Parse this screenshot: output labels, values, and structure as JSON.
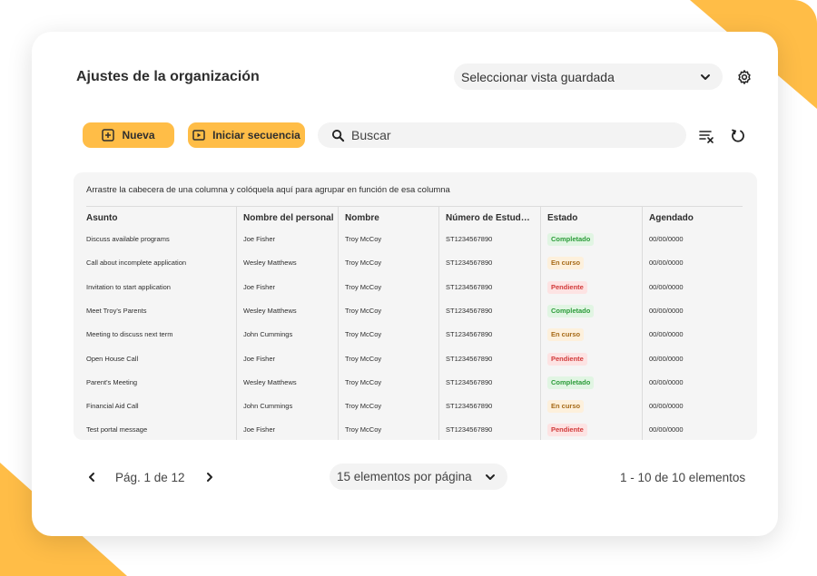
{
  "colors": {
    "accent": "#ffbd47",
    "completed": "#2c9c3a",
    "in_progress": "#a66a18",
    "pending": "#d13b3b"
  },
  "header": {
    "title": "Ajustes de la organización",
    "saved_view_select": "Seleccionar vista guardada",
    "settings_icon": "gear-icon"
  },
  "toolbar": {
    "new_label": "Nueva",
    "sequence_label": "Iniciar secuencia",
    "search_placeholder": "Buscar",
    "clear_filters_icon": "clear-filter-icon",
    "refresh_icon": "refresh-icon"
  },
  "table": {
    "group_hint": "Arrastre la cabecera de una columna y colóquela aquí para agrupar en función de esa columna",
    "columns": [
      "Asunto",
      "Nombre del personal",
      "Nombre",
      "Número de Estud…",
      "Estado",
      "Agendado"
    ],
    "rows": [
      {
        "asunto": "Discuss available programs",
        "personal": "Joe Fisher",
        "nombre": "Troy McCoy",
        "numero": "ST1234567890",
        "estado": "Completado",
        "estado_kind": "comp",
        "agendado": "00/00/0000"
      },
      {
        "asunto": "Call about incomplete application",
        "personal": "Wesley  Matthews",
        "nombre": "Troy McCoy",
        "numero": "ST1234567890",
        "estado": "En curso",
        "estado_kind": "curso",
        "agendado": "00/00/0000"
      },
      {
        "asunto": "Invitation to start application",
        "personal": "Joe Fisher",
        "nombre": "Troy McCoy",
        "numero": "ST1234567890",
        "estado": "Pendiente",
        "estado_kind": "pend",
        "agendado": "00/00/0000"
      },
      {
        "asunto": "Meet Troy's Parents",
        "personal": "Wesley  Matthews",
        "nombre": "Troy McCoy",
        "numero": "ST1234567890",
        "estado": "Completado",
        "estado_kind": "comp",
        "agendado": "00/00/0000"
      },
      {
        "asunto": "Meeting to discuss next term",
        "personal": "John Cummings",
        "nombre": "Troy McCoy",
        "numero": "ST1234567890",
        "estado": "En curso",
        "estado_kind": "curso",
        "agendado": "00/00/0000"
      },
      {
        "asunto": "Open House Call",
        "personal": "Joe Fisher",
        "nombre": "Troy McCoy",
        "numero": "ST1234567890",
        "estado": "Pendiente",
        "estado_kind": "pend",
        "agendado": "00/00/0000"
      },
      {
        "asunto": "Parent's Meeting",
        "personal": "Wesley  Matthews",
        "nombre": "Troy McCoy",
        "numero": "ST1234567890",
        "estado": "Completado",
        "estado_kind": "comp",
        "agendado": "00/00/0000"
      },
      {
        "asunto": "Financial Aid Call",
        "personal": "John Cummings",
        "nombre": "Troy McCoy",
        "numero": "ST1234567890",
        "estado": "En curso",
        "estado_kind": "curso",
        "agendado": "00/00/0000"
      },
      {
        "asunto": "Test portal message",
        "personal": "Joe Fisher",
        "nombre": "Troy McCoy",
        "numero": "ST1234567890",
        "estado": "Pendiente",
        "estado_kind": "pend",
        "agendado": "00/00/0000"
      }
    ]
  },
  "pagination": {
    "page_label": "Pág. 1 de 12",
    "per_page": "15 elementos por página",
    "range": "1 - 10 de 10 elementos"
  }
}
